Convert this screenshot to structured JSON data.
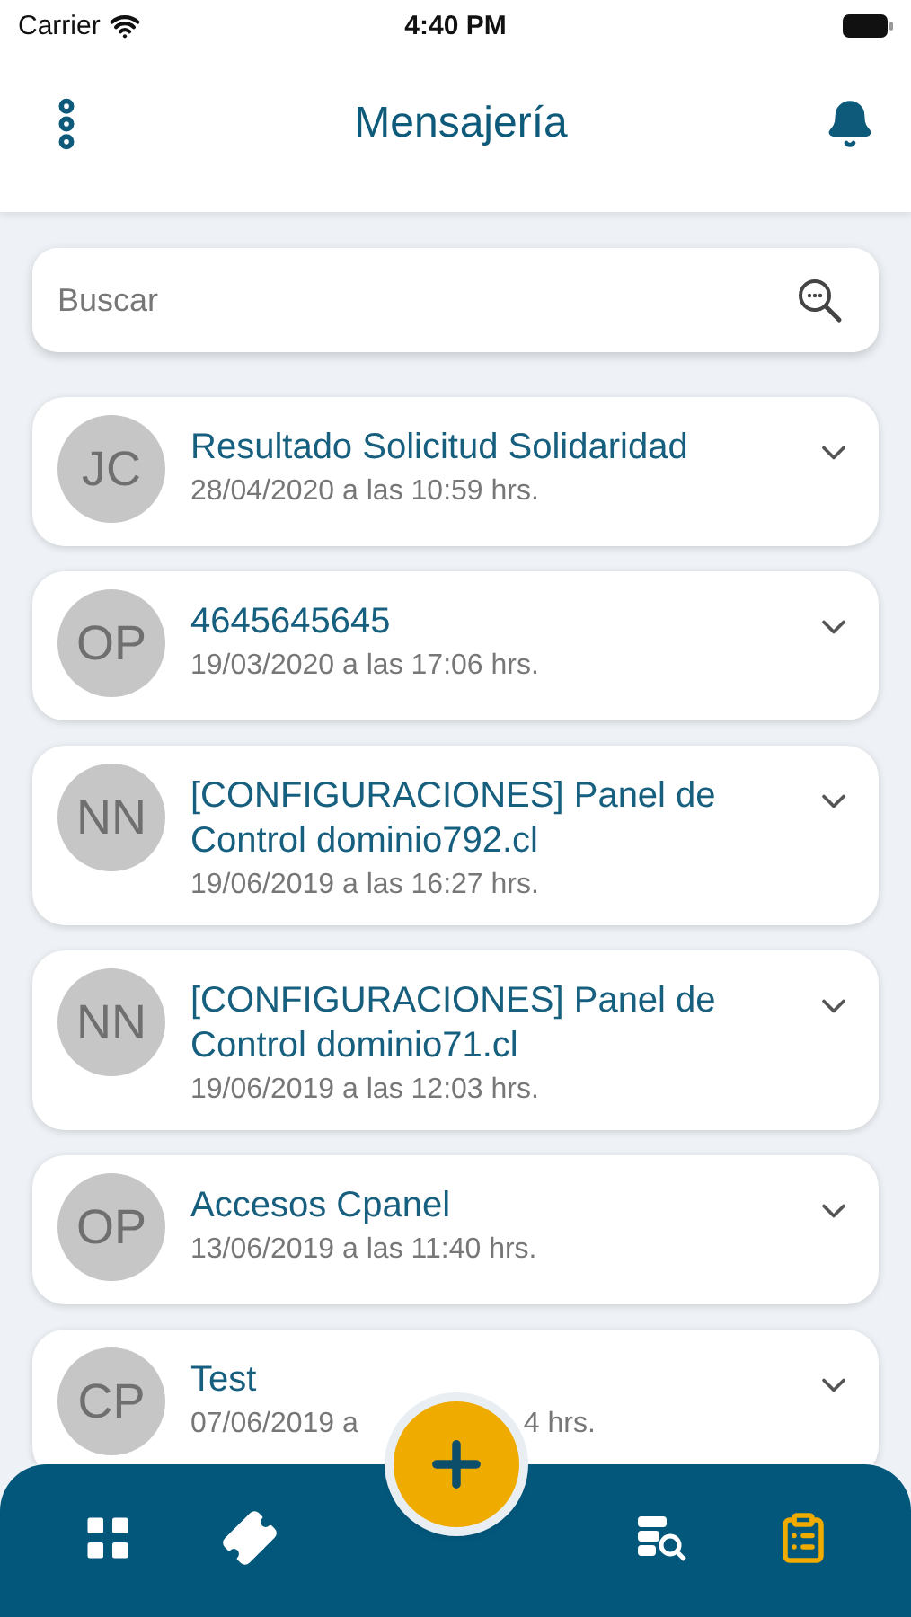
{
  "status_bar": {
    "carrier": "Carrier",
    "time": "4:40 PM"
  },
  "header": {
    "title": "Mensajería"
  },
  "search": {
    "placeholder": "Buscar"
  },
  "messages": [
    {
      "initials": "JC",
      "title": "Resultado Solicitud Solidaridad",
      "date": "28/04/2020 a las 10:59 hrs."
    },
    {
      "initials": "OP",
      "title": "4645645645",
      "date": "19/03/2020 a las 17:06 hrs."
    },
    {
      "initials": "NN",
      "title": "[CONFIGURACIONES] Panel de Control dominio792.cl",
      "date": "19/06/2019 a las 16:27 hrs."
    },
    {
      "initials": "NN",
      "title": "[CONFIGURACIONES] Panel de Control dominio71.cl",
      "date": "19/06/2019 a las 12:03 hrs."
    },
    {
      "initials": "OP",
      "title": "Accesos Cpanel",
      "date": "13/06/2019 a las 11:40 hrs."
    },
    {
      "initials": "CP",
      "title": "Test",
      "date": "07/06/2019 a",
      "date_end": "4 hrs."
    }
  ],
  "bottom_nav": [
    {
      "kind": "grid",
      "selected": false
    },
    {
      "kind": "ticket",
      "selected": false
    },
    {
      "kind": "data-search",
      "selected": false
    },
    {
      "kind": "clipboard",
      "selected": true
    }
  ]
}
